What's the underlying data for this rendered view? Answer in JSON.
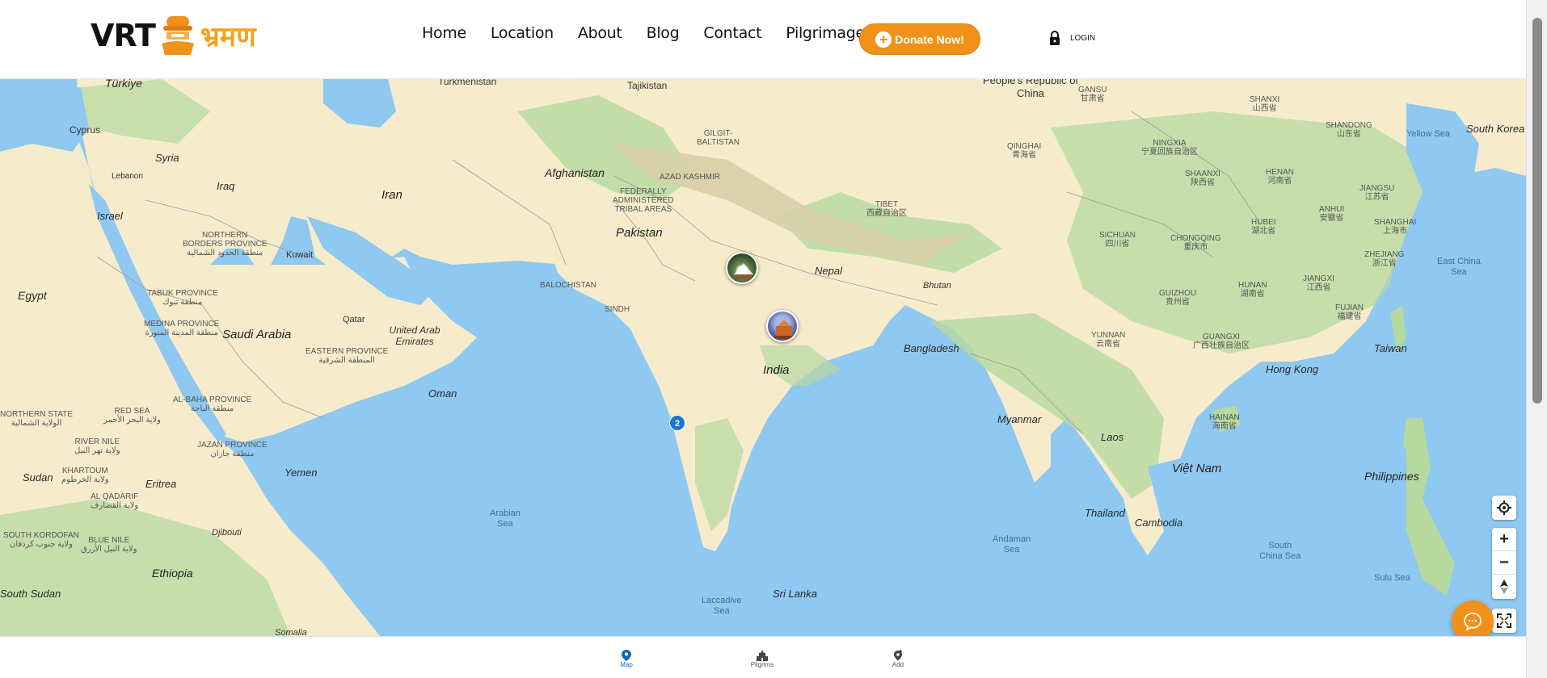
{
  "header": {
    "logo_text": "VRT",
    "logo_deva": "भ्रमण",
    "nav": [
      "Home",
      "Location",
      "About",
      "Blog",
      "Contact",
      "Pilgrimages"
    ],
    "donate_label": "Donate Now!",
    "login_label": "LOGIN"
  },
  "map": {
    "labels": {
      "turkiye": "Türkiye",
      "turkmenistan": "Turkmenistan",
      "tajikistan": "Tajikistan",
      "china_en": "People's Republic of China",
      "gansu": "GANSU\n甘肃省",
      "cyprus": "Cyprus",
      "syria": "Syria",
      "lebanon": "Lebanon",
      "iraq": "Iraq",
      "israel": "Israel",
      "iran": "Iran",
      "afghanistan": "Afghanistan",
      "pakistan": "Pakistan",
      "nepal": "Nepal",
      "bhutan": "Bhutan",
      "egypt": "Egypt",
      "saudi": "Saudi Arabia",
      "kuwait": "Kuwait",
      "qatar": "Qatar",
      "uae": "United Arab Emirates",
      "oman": "Oman",
      "yemen": "Yemen",
      "india": "India",
      "bangladesh": "Bangladesh",
      "myanmar": "Myanmar",
      "laos": "Laos",
      "thailand": "Thailand",
      "cambodia": "Cambodia",
      "vietnam": "Việt Nam",
      "philippines": "Philippines",
      "taiwan": "Taiwan",
      "hongkong": "Hong Kong",
      "sudan": "Sudan",
      "eritrea": "Eritrea",
      "djibouti": "Djibouti",
      "ethiopia": "Ethiopia",
      "southsudan": "South Sudan",
      "somalia": "Somalia",
      "srilanka": "Sri Lanka",
      "southkorea": "South Korea",
      "northern_borders": "NORTHERN\nBORDERS PROVINCE\nمنطقة الحدود الشمالية",
      "tabuk": "TABUK PROVINCE\nمنطقة تبوك",
      "medina": "MEDINA PROVINCE\nمنطقة المدينة المنورة",
      "eastern": "EASTERN PROVINCE\nالمنطقة الشرقية",
      "albaha": "AL-BAHA PROVINCE\nمنطقة الباحة",
      "jazan": "JAZAN PROVINCE\nمنطقة جازان",
      "redsea": "RED SEA\nولاية البحر الأحمر",
      "northernstate": "NORTHERN STATE\nالولاية الشمالية",
      "rivernile": "RIVER NILE\nولاية نهر النيل",
      "khartoum": "KHARTOUM\nولاية الخرطوم",
      "alqadarif": "AL QADARIF\nولاية القضارف",
      "southkordofan": "SOUTH KORDOFAN\nولاية جنوب كردفان",
      "bluenile": "BLUE NILE\nولاية النيل الأزرق",
      "balochistan": "BALOCHISTAN",
      "sindh": "SINDH",
      "fata": "FEDERALLY\nADMINISTERED\nTRIBAL AREAS",
      "azad": "AZAD KASHMIR",
      "gilgit": "GILGIT-\nBALTISTAN",
      "tibet": "TIBET\n西藏自治区",
      "qinghai": "QINGHAI\n青海省",
      "ningxia": "NINGXIA\n宁夏回族自治区",
      "shanxi": "SHANXI\n山西省",
      "shandong": "SHANDONG\n山东省",
      "henan": "HENAN\n河南省",
      "shaanxi": "SHAANXI\n陕西省",
      "jiangsu": "JIANGSU\n江苏省",
      "anhui": "ANHUI\n安徽省",
      "shanghai": "SHANGHAI\n上海市",
      "hubei": "HUBEI\n湖北省",
      "sichuan": "SICHUAN\n四川省",
      "chongqing": "CHONGQING\n重庆市",
      "zhejiang": "ZHEJIANG\n浙江省",
      "hunan": "HUNAN\n湖南省",
      "jiangxi": "JIANGXI\n江西省",
      "guizhou": "GUIZHOU\n贵州省",
      "fujian": "FUJIAN\n福建省",
      "yunnan": "YUNNAN\n云南省",
      "guangxi": "GUANGXI\n广西壮族自治区",
      "hainan": "HAINAN\n海南省",
      "yellowsea": "Yellow Sea",
      "eastchinasea": "East China\nSea",
      "southchinasea": "South\nChina Sea",
      "sulusea": "Sulu Sea",
      "arabiansea": "Arabian\nSea",
      "andamansea": "Andaman\nSea",
      "laccadivesea": "Laccadive\nSea"
    },
    "cluster_count": "2"
  },
  "controls": {
    "zoom_in": "+",
    "zoom_out": "−"
  },
  "bottom_tabs": [
    "Map",
    "Pilgrims",
    "Add"
  ],
  "colors": {
    "accent": "#f0921a",
    "water": "#8fc8f0",
    "land": "#f6eccc",
    "green": "#b6d9a0",
    "link": "#1565c0"
  }
}
